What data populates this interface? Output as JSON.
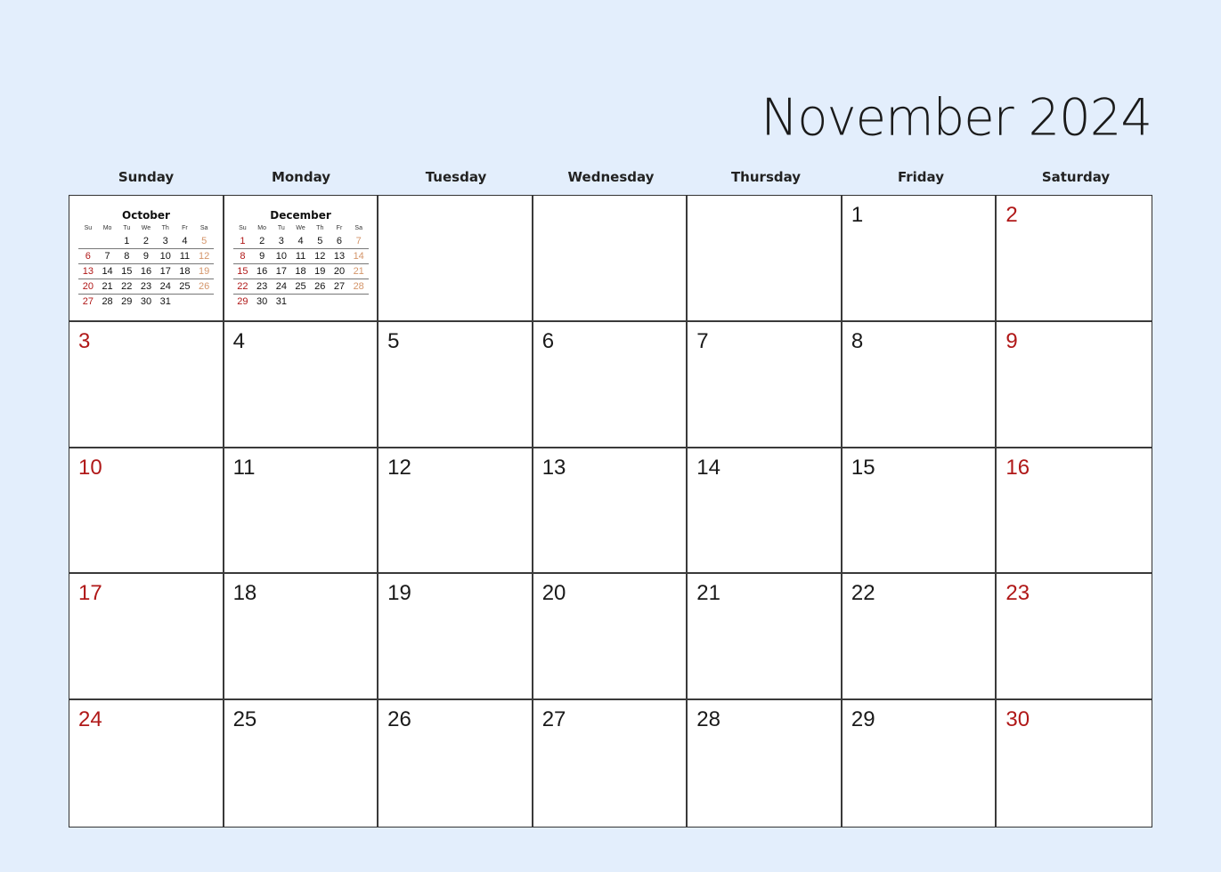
{
  "title": "November 2024",
  "colors": {
    "background": "#e3eefc",
    "weekend": "#b01818",
    "mini_saturday": "#d4956a",
    "text": "#1a1a1a",
    "grid_line": "#3a3a3a"
  },
  "weekdays": [
    "Sunday",
    "Monday",
    "Tuesday",
    "Wednesday",
    "Thursday",
    "Friday",
    "Saturday"
  ],
  "mini_calendars": [
    {
      "month": "October",
      "headers": [
        "Su",
        "Mo",
        "Tu",
        "We",
        "Th",
        "Fr",
        "Sa"
      ],
      "weeks": [
        [
          "",
          "",
          "1",
          "2",
          "3",
          "4",
          "5"
        ],
        [
          "6",
          "7",
          "8",
          "9",
          "10",
          "11",
          "12"
        ],
        [
          "13",
          "14",
          "15",
          "16",
          "17",
          "18",
          "19"
        ],
        [
          "20",
          "21",
          "22",
          "23",
          "24",
          "25",
          "26"
        ],
        [
          "27",
          "28",
          "29",
          "30",
          "31",
          "",
          ""
        ]
      ]
    },
    {
      "month": "December",
      "headers": [
        "Su",
        "Mo",
        "Tu",
        "We",
        "Th",
        "Fr",
        "Sa"
      ],
      "weeks": [
        [
          "1",
          "2",
          "3",
          "4",
          "5",
          "6",
          "7"
        ],
        [
          "8",
          "9",
          "10",
          "11",
          "12",
          "13",
          "14"
        ],
        [
          "15",
          "16",
          "17",
          "18",
          "19",
          "20",
          "21"
        ],
        [
          "22",
          "23",
          "24",
          "25",
          "26",
          "27",
          "28"
        ],
        [
          "29",
          "30",
          "31",
          "",
          "",
          "",
          ""
        ]
      ]
    }
  ],
  "weeks": [
    [
      "",
      "",
      "",
      "",
      "",
      "1",
      "2"
    ],
    [
      "3",
      "4",
      "5",
      "6",
      "7",
      "8",
      "9"
    ],
    [
      "10",
      "11",
      "12",
      "13",
      "14",
      "15",
      "16"
    ],
    [
      "17",
      "18",
      "19",
      "20",
      "21",
      "22",
      "23"
    ],
    [
      "24",
      "25",
      "26",
      "27",
      "28",
      "29",
      "30"
    ]
  ]
}
